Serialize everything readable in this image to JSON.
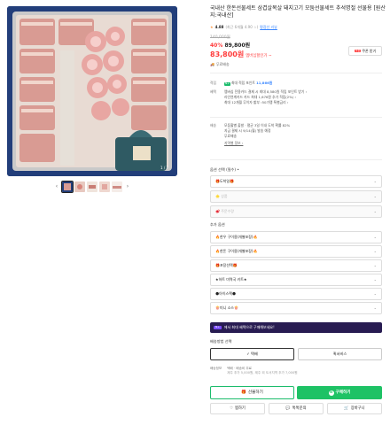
{
  "product": {
    "title": "국내산 한돈선물세트 삼겹살목살 돼지고기 모둠선물세트 추석명절 선물용 [원산지:국내산]",
    "rating": "4.88",
    "rating_meta": "(최근 6개월 4.90 ☆)",
    "review_link": "평점선 리뷰",
    "original_price": "140,000원",
    "discount_pct": "40%",
    "discount_price": "89,800원",
    "member_price": "83,800원",
    "member_label": "멤버십할인가 ~",
    "coupon_badge": "쿠폰",
    "coupon_label": "쿠폰 받기",
    "share_label": "무료배송"
  },
  "info": {
    "points_key": "적립",
    "points_tag": "N+",
    "points_text": "최대 적립 포인트",
    "points_value": "11,866원",
    "benefit_key": "혜택",
    "benefits": [
      "멤버십 전용카드 결제 시 최대 8,580원 적립 포인트 받기 ›",
      "라인연계카드 카드 최대 1,676원 추가 적립(2%) ›",
      "최대 12개월 무이자 할부 ›50가맹 특별금리 ›"
    ],
    "delivery_key": "배송",
    "delivery_lines": [
      "모둠활별 출발 · 평균 3일 이내 도착 확률 82%",
      "지금 결제 시 9/14(월) 발송 예정",
      "무료배송"
    ],
    "delivery_link": "지역별 정보 ›"
  },
  "options": {
    "required_label": "옵션 선택 (필수) •",
    "selects": [
      {
        "label": "🎁도착일🎁",
        "disabled": false
      },
      {
        "label": "🌟 상품",
        "disabled": true
      },
      {
        "label": "🥩 주문수량",
        "disabled": true
      }
    ],
    "extra_label": "추가 옵션",
    "extras": [
      "🔥한우 구이용(개별포장)🔥",
      "🔥한돈 구이용(개별포장)🔥",
      "🎁포장선택🎁",
      "★하트 미역국 키트★",
      "🌑아이스팩🌑",
      "🍿미니 소스🍿"
    ]
  },
  "promo": {
    "badge": "N+",
    "text": "에서 최대 혜택으로 구매해보세요!"
  },
  "shipping": {
    "label": "배송방법 선택",
    "opt1": "✓ 택배",
    "opt2": "퀵서비스",
    "info_key": "배송정보",
    "info_text": "택배 · 배송비 무료",
    "info_sub": "제주 추가 5,000원, 제주 외 도서지역 추가 7,000원"
  },
  "actions": {
    "gift": "선물하기",
    "buy": "구매하기",
    "like": "찜하기",
    "inquiry": "톡톡문의",
    "cart": "장바구니"
  },
  "gallery": {
    "counter": "1 / 7",
    "prev": "‹",
    "next": "›"
  }
}
